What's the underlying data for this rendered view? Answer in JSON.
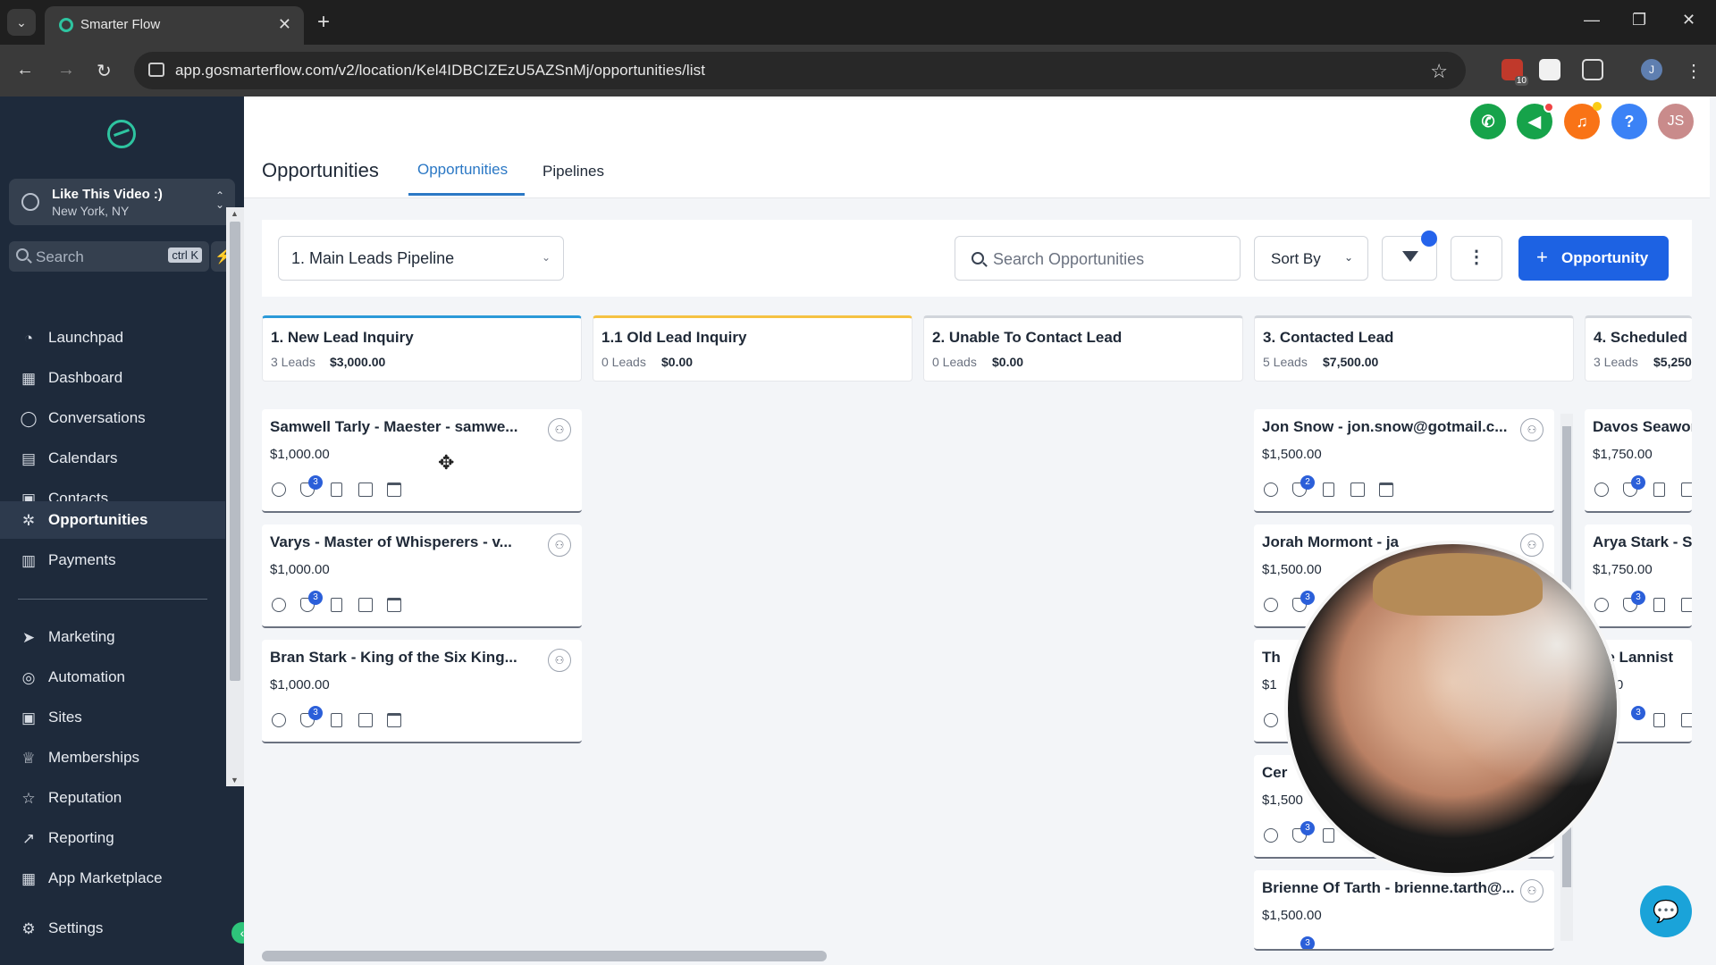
{
  "browser": {
    "tab_title": "Smarter Flow",
    "url": "app.gosmarterflow.com/v2/location/Kel4IDBCIZEzU5AZSnMj/opportunities/list",
    "extension_badge": "10",
    "profile_initial": "J"
  },
  "sidebar": {
    "account": {
      "name": "Like This Video :)",
      "location": "New York, NY"
    },
    "search": {
      "placeholder": "Search",
      "shortcut": "ctrl K"
    },
    "items": [
      {
        "label": "Launchpad",
        "icon": "rocket-icon"
      },
      {
        "label": "Dashboard",
        "icon": "grid-icon"
      },
      {
        "label": "Conversations",
        "icon": "chat-icon"
      },
      {
        "label": "Calendars",
        "icon": "calendar-icon"
      },
      {
        "label": "Contacts",
        "icon": "contacts-icon"
      },
      {
        "label": "Opportunities",
        "icon": "network-icon",
        "active": true
      },
      {
        "label": "Payments",
        "icon": "receipt-icon"
      },
      {
        "label": "Marketing",
        "icon": "send-icon"
      },
      {
        "label": "Automation",
        "icon": "automation-icon"
      },
      {
        "label": "Sites",
        "icon": "globe-icon"
      },
      {
        "label": "Memberships",
        "icon": "membership-icon"
      },
      {
        "label": "Reputation",
        "icon": "star-icon"
      },
      {
        "label": "Reporting",
        "icon": "trend-icon"
      },
      {
        "label": "App Marketplace",
        "icon": "apps-icon"
      }
    ],
    "settings_label": "Settings"
  },
  "header": {
    "title": "Opportunities",
    "tabs": [
      {
        "label": "Opportunities",
        "active": true
      },
      {
        "label": "Pipelines"
      }
    ],
    "user_initials": "JS"
  },
  "controls": {
    "pipeline": "1. Main Leads Pipeline",
    "search_placeholder": "Search Opportunities",
    "sort_label": "Sort By",
    "add_label": "Opportunity"
  },
  "stages": [
    {
      "name": "1. New Lead Inquiry",
      "count": "3 Leads",
      "value": "$3,000.00",
      "color": "#2b9ad9"
    },
    {
      "name": "1.1 Old Lead Inquiry",
      "count": "0 Leads",
      "value": "$0.00",
      "color": "#f5c242"
    },
    {
      "name": "2. Unable To Contact Lead",
      "count": "0 Leads",
      "value": "$0.00",
      "color": "#d1d5db"
    },
    {
      "name": "3. Contacted Lead",
      "count": "5 Leads",
      "value": "$7,500.00",
      "color": "#d1d5db"
    },
    {
      "name": "4. Scheduled",
      "count": "3 Leads",
      "value": "$5,250",
      "color": "#d1d5db"
    }
  ],
  "cards": {
    "col1": [
      {
        "title": "Samwell Tarly - Maester - samwe...",
        "amount": "$1,000.00",
        "badge": "3"
      },
      {
        "title": "Varys - Master of Whisperers - v...",
        "amount": "$1,000.00",
        "badge": "3"
      },
      {
        "title": "Bran Stark - King of the Six King...",
        "amount": "$1,000.00",
        "badge": "3"
      }
    ],
    "col4": [
      {
        "title": "Jon Snow - jon.snow@gotmail.c...",
        "amount": "$1,500.00",
        "badge": "2"
      },
      {
        "title": "Jorah Mormont - ja",
        "amount": "$1,500.00",
        "badge": "3"
      },
      {
        "title": "Th",
        "amount": "$1",
        "badge": ""
      },
      {
        "title": "Cer",
        "amount": "$1,500",
        "badge": "3"
      },
      {
        "title": "Brienne Of Tarth - brienne.tarth@...",
        "amount": "$1,500.00",
        "badge": "3"
      }
    ],
    "col5": [
      {
        "title": "Davos Seawor",
        "amount": "$1,750.00",
        "badge": "3"
      },
      {
        "title": "Arya Stark - S",
        "amount": "$1,750.00",
        "badge": "3"
      },
      {
        "title": "ne Lannist",
        "amount": "0.00",
        "badge": "3"
      }
    ]
  }
}
